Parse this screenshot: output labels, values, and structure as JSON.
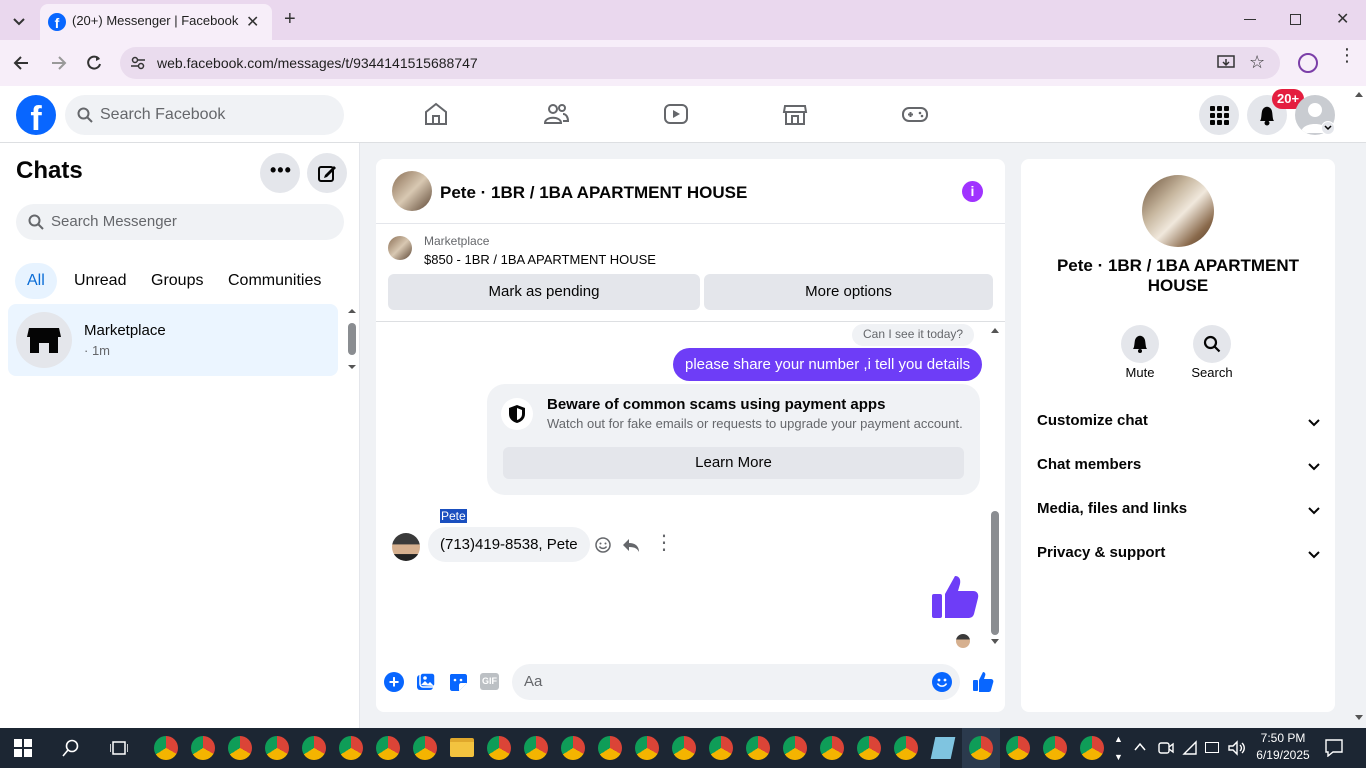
{
  "browser": {
    "tab_title": "(20+) Messenger | Facebook",
    "url": "web.facebook.com/messages/t/9344141515688747"
  },
  "fb": {
    "search_placeholder": "Search Facebook",
    "notification_badge": "20+"
  },
  "left": {
    "title": "Chats",
    "search_placeholder": "Search Messenger",
    "filters": [
      "All",
      "Unread",
      "Groups",
      "Communities"
    ],
    "chat": {
      "name": "Marketplace",
      "meta": "· 1m"
    }
  },
  "conversation": {
    "title": "Pete · 1BR / 1BA APARTMENT HOUSE",
    "listing_source": "Marketplace",
    "listing": "$850 - 1BR / 1BA APARTMENT HOUSE",
    "mark_pending": "Mark as pending",
    "more_options": "More options",
    "quoted_message": "Can I see it today?",
    "sent_message": "please share your number ,i tell you details",
    "warning_title": "Beware of common scams using payment apps",
    "warning_body": "Watch out for fake emails or requests to upgrade your payment account.",
    "learn_more": "Learn More",
    "sender_name": "Pete",
    "received_message": "(713)419-8538, Pete",
    "composer_placeholder": "Aa"
  },
  "right": {
    "name": "Pete · 1BR / 1BA APARTMENT HOUSE",
    "mute": "Mute",
    "search": "Search",
    "sections": [
      "Customize chat",
      "Chat members",
      "Media, files and links",
      "Privacy & support"
    ]
  },
  "taskbar": {
    "time": "7:50 PM",
    "date": "6/19/2025"
  },
  "colors": {
    "fb_blue": "#0866ff",
    "messenger_purple": "#6e3df7",
    "badge_red": "#e41e3f"
  }
}
